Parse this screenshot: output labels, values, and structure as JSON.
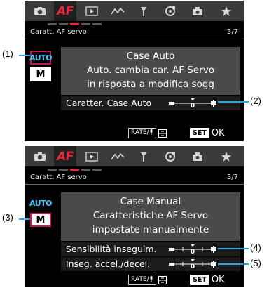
{
  "screen1": {
    "title": "Caratt. AF servo",
    "page": "3/7",
    "mode_auto": "AUTO",
    "mode_manual": "M",
    "desc_lines": [
      "Case Auto",
      "Auto. cambia car. AF Servo",
      "in risposta a modifica sogg"
    ],
    "param1_label": "Caratter. Case Auto",
    "param1_value": "0",
    "rate_label": "RATE",
    "set_label": "SET",
    "ok_label": "OK"
  },
  "screen2": {
    "title": "Caratt. AF servo",
    "page": "3/7",
    "mode_auto": "AUTO",
    "mode_manual": "M",
    "desc_lines": [
      "Case Manual",
      "Caratteristiche AF Servo",
      "impostate manualmente"
    ],
    "param1_label": "Sensibilità inseguim.",
    "param1_value": "0",
    "param2_label": "Inseg. accel./decel.",
    "param2_value": "0",
    "rate_label": "RATE",
    "set_label": "SET",
    "ok_label": "OK"
  },
  "tabs": [
    "camera-icon",
    "AF",
    "playback-icon",
    "wireless-icon",
    "wrench-icon",
    "custom-function-icon",
    "my-menu-camera-icon",
    "star-icon"
  ],
  "active_tab": "AF",
  "callouts": [
    "(1)",
    "(2)",
    "(3)",
    "(4)",
    "(5)"
  ],
  "colors": {
    "accent_red": "#e8283d",
    "selection_magenta": "#c2185b",
    "auto_blue": "#4fc3f7",
    "callout_line": "#29a6e0"
  }
}
